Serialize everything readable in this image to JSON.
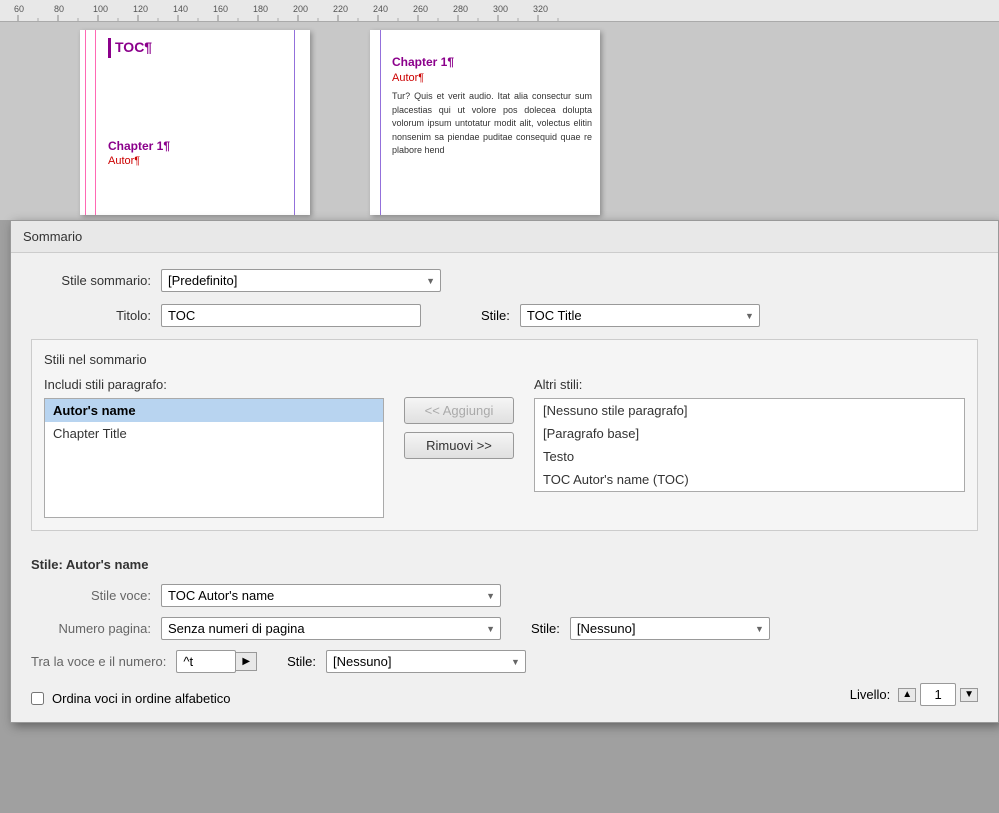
{
  "ruler": {
    "marks": [
      60,
      80,
      100,
      120,
      140,
      160,
      180,
      200,
      220,
      240,
      260,
      280,
      300,
      320
    ]
  },
  "page1": {
    "toc_label": "TOC¶",
    "chapter_label": "Chapter 1¶",
    "author_label": "Autor¶"
  },
  "page2": {
    "chapter_label": "Chapter 1¶",
    "author_label": "Autor¶",
    "body_text": "Tur? Quis et verit audio. Itat alia consectur sum placestias qui ut volore pos dolecea dolupta volorum ipsum untotatur modit alit, volectus elitin nonsenim sa piendae puditae consequid quae re plabore hend"
  },
  "dialog": {
    "title": "Sommario",
    "stile_sommario_label": "Stile sommario:",
    "stile_sommario_value": "[Predefinito]",
    "titolo_label": "Titolo:",
    "titolo_value": "TOC",
    "stile_label": "Stile:",
    "stile_value": "TOC Title",
    "stili_nel_sommario_label": "Stili nel sommario",
    "includi_label": "Includi stili paragrafo:",
    "altri_label": "Altri stili:",
    "includi_items": [
      {
        "text": "Autor's name",
        "selected": true
      },
      {
        "text": "Chapter Title",
        "selected": false
      }
    ],
    "altri_items": [
      {
        "text": "[Nessuno stile paragrafo]"
      },
      {
        "text": "[Paragrafo base]"
      },
      {
        "text": "Testo"
      },
      {
        "text": "TOC Autor's name (TOC)"
      }
    ],
    "aggiungi_btn": "<< Aggiungi",
    "rimuovi_btn": "Rimuovi >>",
    "stile_detail_title": "Stile: Autor's name",
    "stile_voce_label": "Stile voce:",
    "stile_voce_value": "TOC Autor's name",
    "numero_pagina_label": "Numero pagina:",
    "numero_pagina_value": "Senza numeri di pagina",
    "stile_right1_label": "Stile:",
    "stile_right1_value": "[Nessuno]",
    "tra_label": "Tra la voce e il numero:",
    "tra_value": "^t",
    "stile_right2_label": "Stile:",
    "stile_right2_value": "[Nessuno]",
    "ordina_label": "Ordina voci in ordine alfabetico",
    "livello_label": "Livello:",
    "livello_value": "1"
  }
}
